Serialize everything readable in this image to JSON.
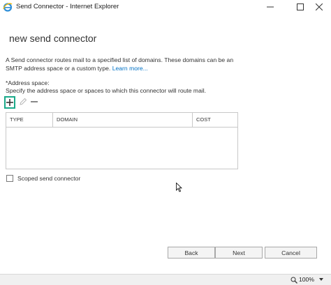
{
  "window": {
    "title": "Send Connector - Internet Explorer"
  },
  "page": {
    "title": "new send connector",
    "description": "A Send connector routes mail to a specified list of domains. These domains can be an SMTP address space or a custom type.",
    "learn_more": "Learn more..."
  },
  "address_space": {
    "label": "*Address space:",
    "sublabel": "Specify the address space or spaces to which this connector will route mail.",
    "toolbar": {
      "add_icon": "plus-icon",
      "edit_icon": "pencil-icon",
      "remove_icon": "minus-icon"
    },
    "columns": [
      "TYPE",
      "DOMAIN",
      "COST"
    ],
    "rows": []
  },
  "scoped": {
    "label": "Scoped send connector",
    "checked": false
  },
  "buttons": {
    "back": "Back",
    "next": "Next",
    "cancel": "Cancel"
  },
  "statusbar": {
    "zoom": "100%"
  },
  "colors": {
    "accent_focus": "#1aa989",
    "link": "#0072c6"
  }
}
